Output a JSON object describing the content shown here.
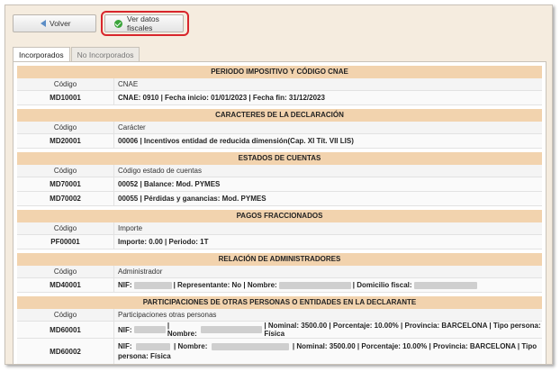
{
  "toolbar": {
    "back_label": "Volver",
    "fiscal_label": "Ver datos fiscales"
  },
  "tabs": [
    {
      "label": "Incorporados",
      "active": true
    },
    {
      "label": "No Incorporados",
      "active": false
    }
  ],
  "sections": {
    "periodo": {
      "title": "PERIODO IMPOSITIVO Y CÓDIGO CNAE",
      "col1": "Código",
      "col2": "CNAE",
      "rows": [
        {
          "code": "MD10001",
          "value": "CNAE: 0910 | Fecha inicio: 01/01/2023 | Fecha fin: 31/12/2023"
        }
      ]
    },
    "caracteres": {
      "title": "CARACTERES DE LA DECLARACIÓN",
      "col1": "Código",
      "col2": "Carácter",
      "rows": [
        {
          "code": "MD20001",
          "value": "00006 | Incentivos entidad de reducida dimensión(Cap. XI Tít. VII LIS)"
        }
      ]
    },
    "estados": {
      "title": "ESTADOS DE CUENTAS",
      "col1": "Código",
      "col2": "Código estado de cuentas",
      "rows": [
        {
          "code": "MD70001",
          "value": "00052 | Balance: Mod. PYMES"
        },
        {
          "code": "MD70002",
          "value": "00055 | Pérdidas y ganancias: Mod. PYMES"
        }
      ]
    },
    "pagos": {
      "title": "PAGOS FRACCIONADOS",
      "col1": "Código",
      "col2": "Importe",
      "rows": [
        {
          "code": "PF00001",
          "value": "Importe: 0.00 | Periodo: 1T"
        }
      ]
    },
    "administradores": {
      "title": "RELACIÓN DE ADMINISTRADORES",
      "col1": "Código",
      "col2": "Administrador",
      "row": {
        "code": "MD40001",
        "nif_label": "NIF:",
        "rep_text": "| Representante: No | Nombre:",
        "dom_text": "| Domicilio fiscal:"
      }
    },
    "participaciones": {
      "title": "PARTICIPACIONES DE OTRAS PERSONAS O ENTIDADES EN LA DECLARANTE",
      "col1": "Código",
      "col2": "Participaciones otras personas",
      "rows": [
        {
          "code": "MD60001",
          "nif_label": "NIF:",
          "nombre_text": "| Nombre:",
          "rest": "| Nominal: 3500.00 | Porcentaje: 10.00% | Provincia: BARCELONA | Tipo persona: Física"
        },
        {
          "code": "MD60002",
          "nif_label": "NIF:",
          "nombre_text": "| Nombre:",
          "rest": "| Nominal: 3500.00 | Porcentaje: 10.00% | Provincia: BARCELONA | Tipo persona: Física"
        }
      ]
    }
  }
}
